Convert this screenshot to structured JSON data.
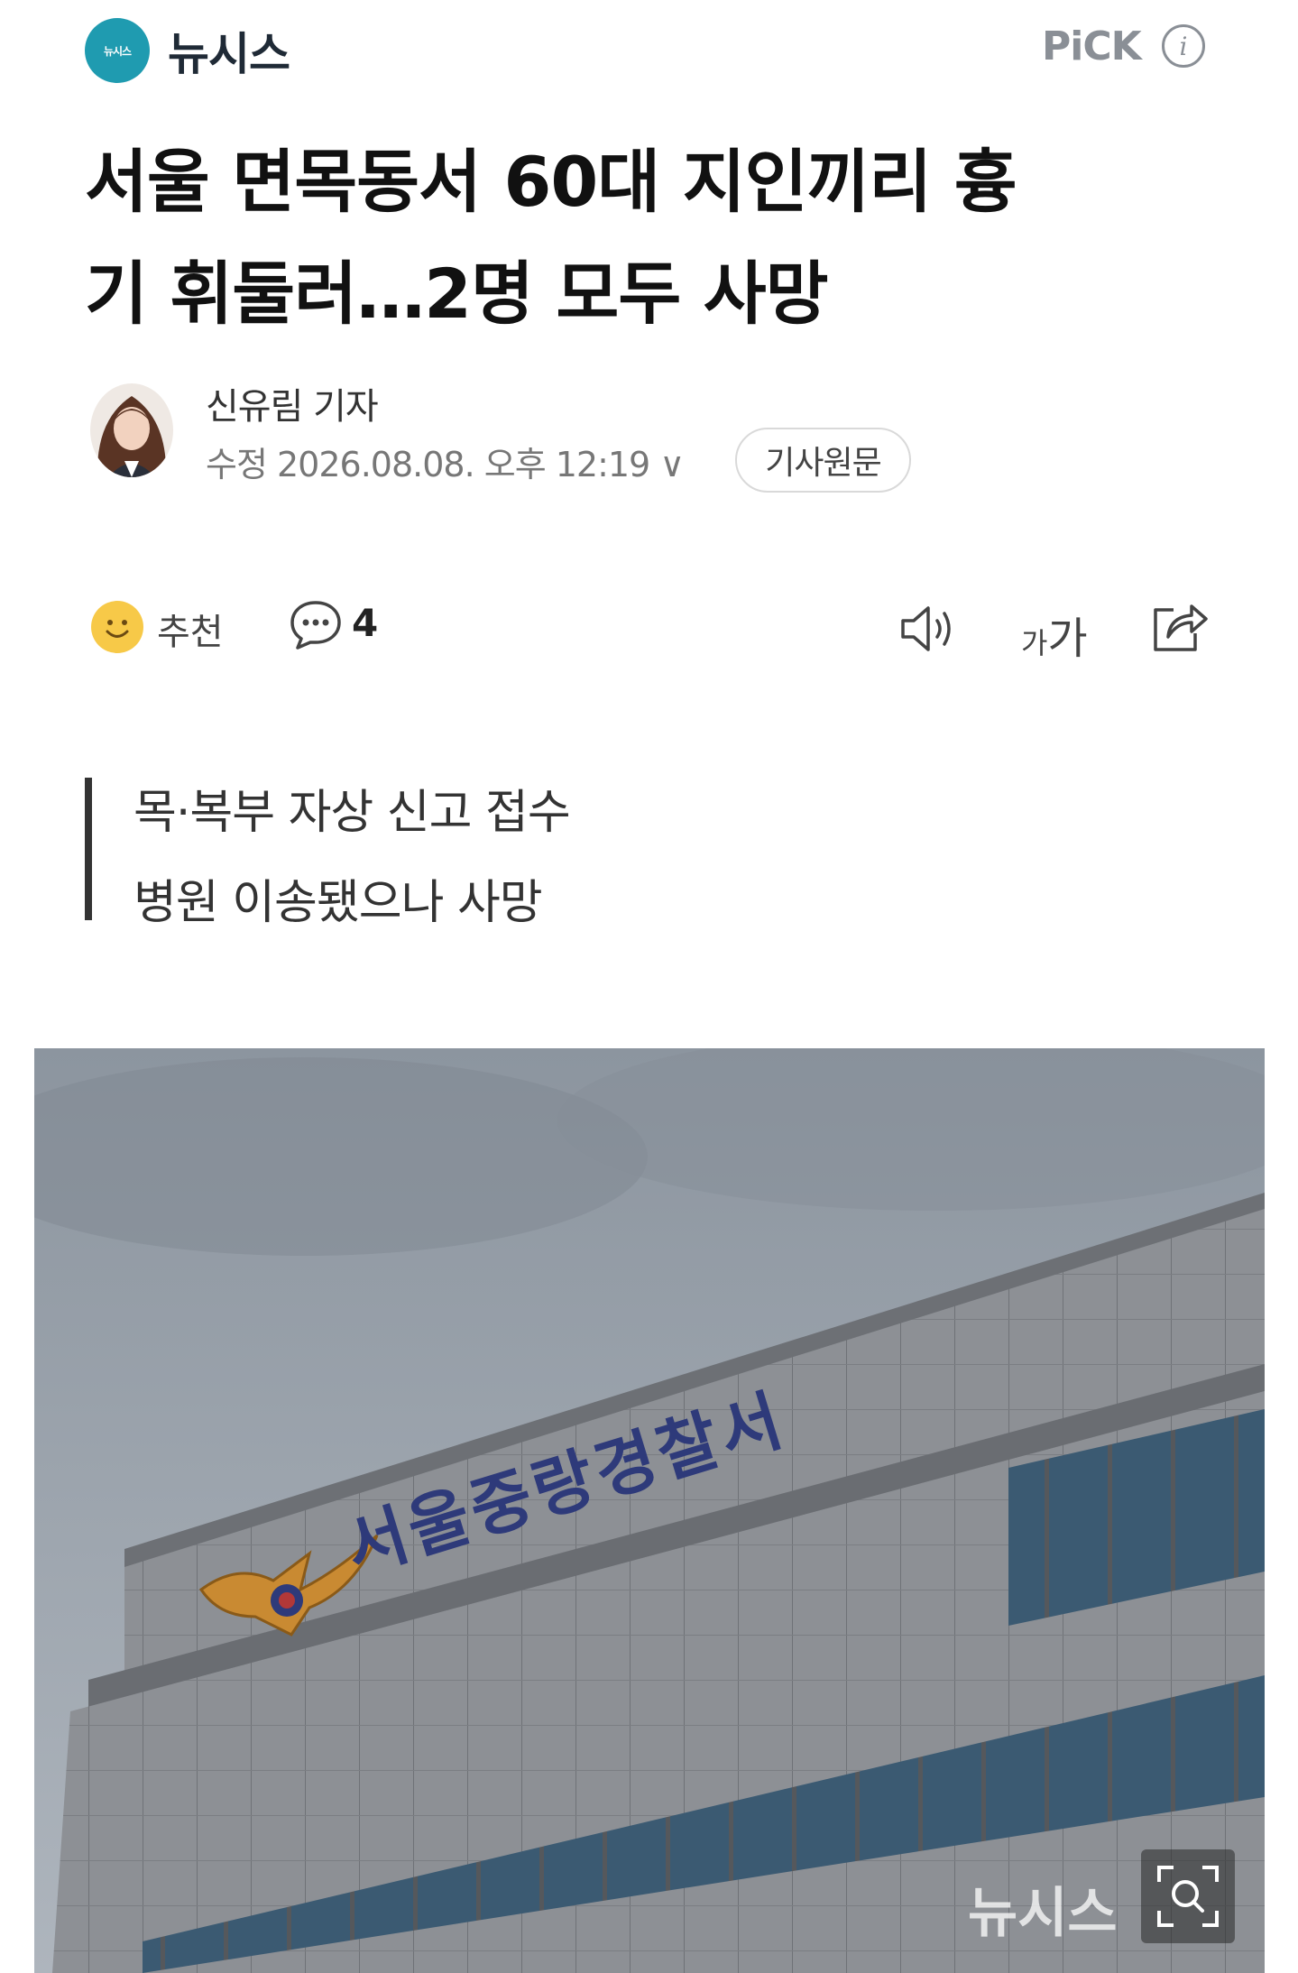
{
  "header": {
    "logo_text": "뉴시스",
    "brand_name": "뉴시스",
    "pick_label": "PiCK",
    "info_icon_text": "i"
  },
  "article": {
    "headline_line1": "서울 면목동서 60대 지인끼리 흉",
    "headline_line2": "기 휘둘러…2명 모두 사망",
    "reporter": "신유림 기자",
    "edit_meta": "수정 2026.08.08. 오후 12:19 ∨",
    "original_button": "기사원문",
    "summary_line1": "목·복부 자상 신고 접수",
    "summary_line2": "병원 이송됐으나 사망"
  },
  "actions": {
    "recommend_label": "추천",
    "comment_count": "4",
    "fontsize_small": "가",
    "fontsize_large": "가"
  },
  "photo": {
    "sign_text": "서울중랑경찰서",
    "watermark": "뉴시스"
  },
  "colors": {
    "brand": "#1f9bb0",
    "sky": "#9aa3ad",
    "building": "#8e9196",
    "sign": "#2e3a7a"
  }
}
